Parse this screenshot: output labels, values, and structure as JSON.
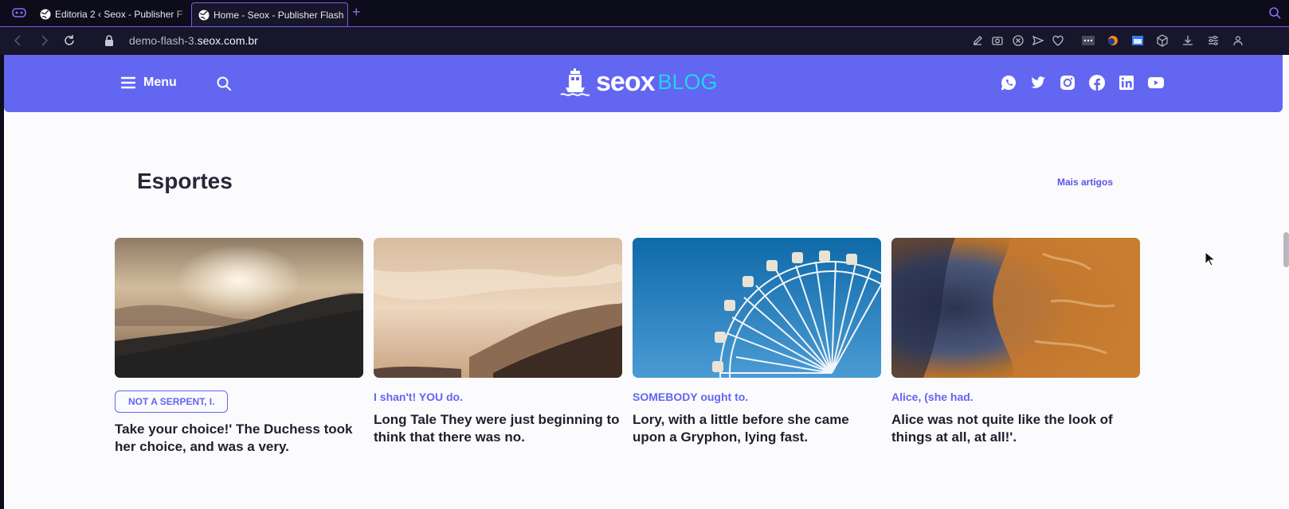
{
  "browser": {
    "tabs": [
      {
        "label": "Editoria 2 ‹ Seox - Publisher Flash",
        "active": false
      },
      {
        "label": "Home - Seox - Publisher Flash",
        "active": true
      }
    ],
    "new_tab": "+",
    "url_prefix": "demo-flash-3.",
    "url_domain": "seox.com.br",
    "accent": "#7b5cf0"
  },
  "header": {
    "menu_label": "Menu",
    "logo_text": "seox",
    "logo_suffix": "BLOG",
    "background": "#6366f1",
    "socials": [
      "whatsapp-icon",
      "twitter-icon",
      "instagram-icon",
      "facebook-icon",
      "linkedin-icon",
      "youtube-icon"
    ]
  },
  "section": {
    "title": "Esportes",
    "more_link": "Mais artigos"
  },
  "cards": [
    {
      "category": "NOT A SERPENT, I.",
      "title": "Take your choice!' The Duchess took her choice, and was a very.",
      "boxed": true
    },
    {
      "category": "I shan't! YOU do.",
      "title": "Long Tale They were just beginning to think that there was no.",
      "boxed": false
    },
    {
      "category": "SOMEBODY ought to.",
      "title": "Lory, with a little before she came upon a Gryphon, lying fast.",
      "boxed": false
    },
    {
      "category": "Alice, (she had.",
      "title": "Alice was not quite like the look of things at all, at all!'.",
      "boxed": false
    }
  ]
}
